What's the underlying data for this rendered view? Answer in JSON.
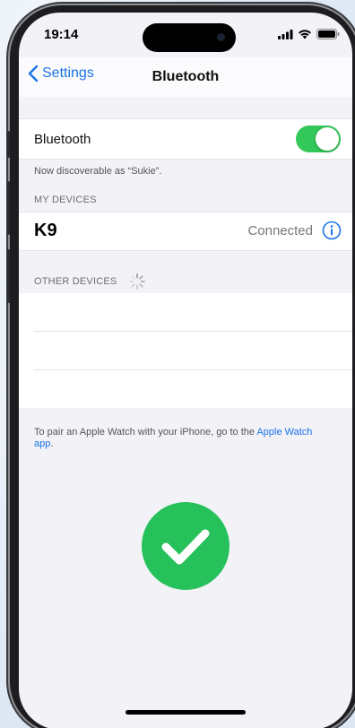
{
  "status_bar": {
    "time": "19:14",
    "icons": [
      "signal-icon",
      "wifi-icon",
      "battery-icon"
    ]
  },
  "nav": {
    "back_label": "Settings",
    "title": "Bluetooth"
  },
  "bluetooth": {
    "label": "Bluetooth",
    "enabled": true,
    "discoverable_text": "Now discoverable as “Sukie”."
  },
  "my_devices": {
    "header": "MY DEVICES",
    "items": [
      {
        "name": "K9",
        "status": "Connected"
      }
    ]
  },
  "other_devices": {
    "header": "OTHER DEVICES",
    "searching": true
  },
  "pair_note": {
    "text": "To pair an Apple Watch with your iPhone, go to the ",
    "link": "Apple Watch app",
    "suffix": "."
  },
  "overlay": {
    "icon": "checkmark-circle-icon"
  },
  "colors": {
    "accent": "#1a73e8",
    "toggle_on": "#34c759",
    "check_green": "#27c15b"
  }
}
